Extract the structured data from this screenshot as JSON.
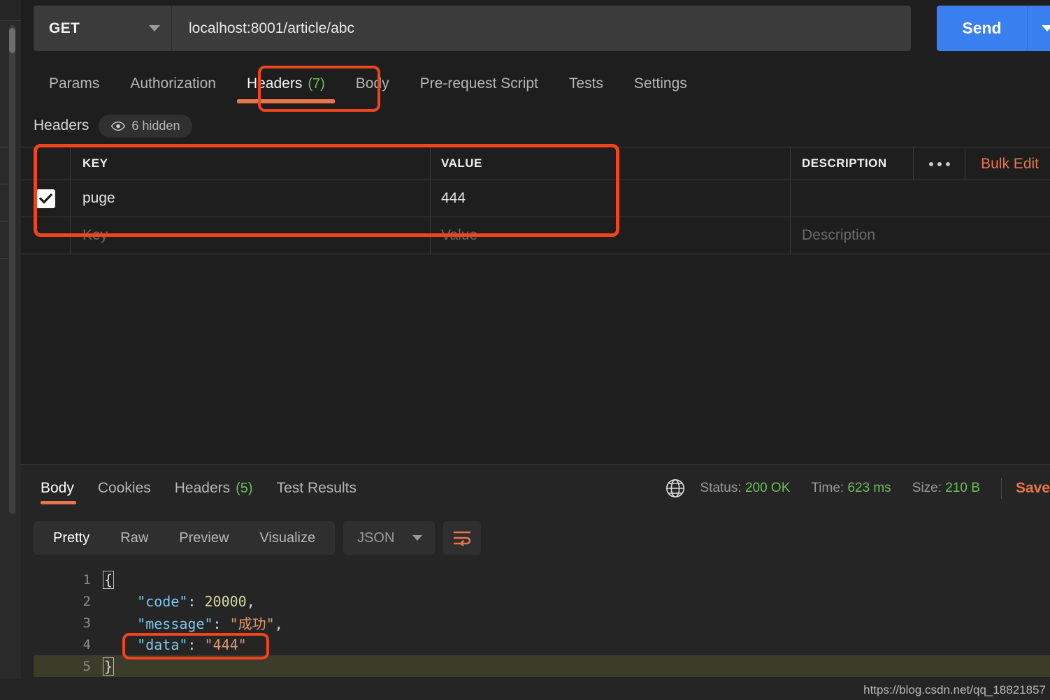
{
  "request": {
    "method": "GET",
    "method_caret_icon": "chevron-down-icon",
    "url": "localhost:8001/article/abc",
    "send_label": "Send",
    "send_caret_icon": "chevron-down-icon",
    "tabs": [
      {
        "label": "Params",
        "count": "",
        "active": false
      },
      {
        "label": "Authorization",
        "count": "",
        "active": false
      },
      {
        "label": "Headers",
        "count": "(7)",
        "active": true
      },
      {
        "label": "Body",
        "count": "",
        "active": false
      },
      {
        "label": "Pre-request Script",
        "count": "",
        "active": false
      },
      {
        "label": "Tests",
        "count": "",
        "active": false
      },
      {
        "label": "Settings",
        "count": "",
        "active": false
      }
    ]
  },
  "headers_section": {
    "title": "Headers",
    "hidden_pill": {
      "icon": "eye-icon",
      "label": "6 hidden"
    },
    "columns": [
      "KEY",
      "VALUE",
      "DESCRIPTION"
    ],
    "dots_icon": "more-options-icon",
    "bulk_edit_label": "Bulk Edit",
    "rows": [
      {
        "checked": true,
        "key": "puge",
        "value": "444",
        "description": ""
      }
    ],
    "placeholder_row": {
      "key": "Key",
      "value": "Value",
      "description": "Description"
    }
  },
  "response": {
    "tabs": [
      {
        "label": "Body",
        "count": "",
        "active": true
      },
      {
        "label": "Cookies",
        "count": "",
        "active": false
      },
      {
        "label": "Headers",
        "count": "(5)",
        "active": false
      },
      {
        "label": "Test Results",
        "count": "",
        "active": false
      }
    ],
    "globe_icon": "globe-icon",
    "status_label": "Status:",
    "status_value": "200 OK",
    "time_label": "Time:",
    "time_value": "623 ms",
    "size_label": "Size:",
    "size_value": "210 B",
    "save_label": "Save",
    "view_modes": [
      {
        "label": "Pretty",
        "active": true
      },
      {
        "label": "Raw",
        "active": false
      },
      {
        "label": "Preview",
        "active": false
      },
      {
        "label": "Visualize",
        "active": false
      }
    ],
    "format": "JSON",
    "format_caret_icon": "chevron-down-icon",
    "wrap_icon": "word-wrap-icon",
    "body_lines": [
      {
        "num": "1",
        "tokens": [
          {
            "t": "{",
            "c": "pun-box"
          }
        ]
      },
      {
        "num": "2",
        "tokens": [
          {
            "t": "    ",
            "c": "pun"
          },
          {
            "t": "\"code\"",
            "c": "key"
          },
          {
            "t": ": ",
            "c": "pun"
          },
          {
            "t": "20000",
            "c": "num"
          },
          {
            "t": ",",
            "c": "pun"
          }
        ]
      },
      {
        "num": "3",
        "tokens": [
          {
            "t": "    ",
            "c": "pun"
          },
          {
            "t": "\"message\"",
            "c": "key"
          },
          {
            "t": ": ",
            "c": "pun"
          },
          {
            "t": "\"成功\"",
            "c": "str"
          },
          {
            "t": ",",
            "c": "pun"
          }
        ]
      },
      {
        "num": "4",
        "tokens": [
          {
            "t": "    ",
            "c": "pun"
          },
          {
            "t": "\"data\"",
            "c": "key"
          },
          {
            "t": ": ",
            "c": "pun"
          },
          {
            "t": "\"444\"",
            "c": "str"
          }
        ]
      },
      {
        "num": "5",
        "tokens": [
          {
            "t": "}",
            "c": "pun-box"
          }
        ],
        "highlight": true
      }
    ]
  },
  "watermark": "https://blog.csdn.net/qq_18821857",
  "colors": {
    "accent_orange": "#e8764a",
    "annotation_red": "#f0441e",
    "send_blue": "#3a7ff0",
    "status_green": "#6bbf59",
    "json_key_blue": "#7fc8ec",
    "json_string": "#dd9a72",
    "json_number": "#d4d8a0"
  }
}
